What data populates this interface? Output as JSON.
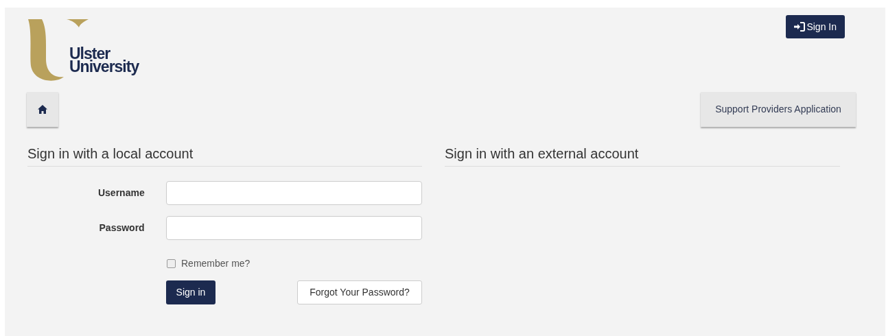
{
  "header": {
    "logo_lines": [
      "Ulster",
      "University"
    ],
    "sign_in_button": "Sign In"
  },
  "nav": {
    "support_button": "Support Providers Application"
  },
  "local": {
    "heading": "Sign in with a local account",
    "fields": [
      {
        "label": "Username"
      },
      {
        "label": "Password"
      }
    ],
    "remember": {
      "label": "Remember me?",
      "checked": false
    },
    "submit": "Sign in",
    "forgot": "Forgot Your Password?"
  },
  "external": {
    "heading": "Sign in with an external account"
  }
}
